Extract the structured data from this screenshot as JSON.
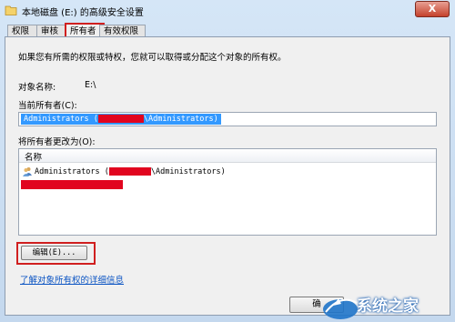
{
  "window": {
    "title": "本地磁盘 (E:) 的高级安全设置",
    "close_glyph": "X"
  },
  "tabs": [
    {
      "label": "权限",
      "active": false
    },
    {
      "label": "审核",
      "active": false
    },
    {
      "label": "所有者",
      "active": true
    },
    {
      "label": "有效权限",
      "active": false
    }
  ],
  "owner_tab": {
    "intro": "如果您有所需的权限或特权，您就可以取得或分配这个对象的所有权。",
    "object_name_label": "对象名称:",
    "object_name_value": "E:\\",
    "current_owner_label": "当前所有者(C):",
    "current_owner_prefix": "Administrators (",
    "current_owner_suffix": "\\Administrators)",
    "change_to_label": "将所有者更改为(O):",
    "list_header": "名称",
    "list_items": [
      {
        "prefix": "Administrators (",
        "suffix": "\\Administrators)"
      }
    ],
    "edit_button": "编辑(E)...",
    "learn_more_link": "了解对象所有权的详细信息",
    "ok_button": "确"
  },
  "watermark": {
    "text": "系统之家"
  },
  "colors": {
    "highlight": "#d01f1f",
    "redaction": "#e1051f",
    "selection": "#3399ff",
    "link": "#0b54c3"
  }
}
